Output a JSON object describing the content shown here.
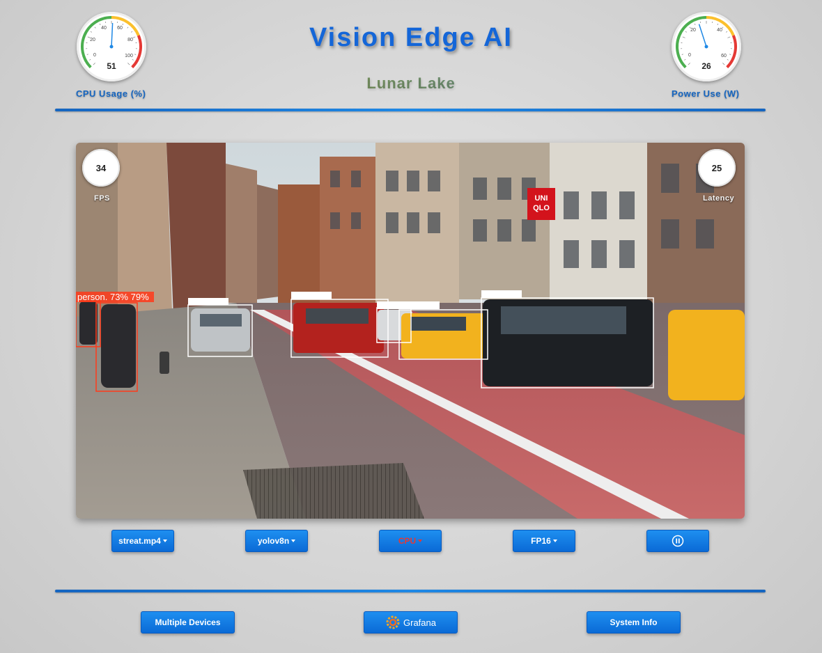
{
  "header": {
    "title": "Vision Edge AI",
    "subtitle": "Lunar Lake"
  },
  "gauges": {
    "cpu": {
      "label": "CPU Usage (%)",
      "value": "51",
      "value_num": 51,
      "min": 0,
      "max": 100,
      "ticks": [
        "0",
        "20",
        "40",
        "60",
        "80",
        "100"
      ]
    },
    "power": {
      "label": "Power Use (W)",
      "value": "26",
      "value_num": 26,
      "min": 0,
      "max": 60,
      "ticks": [
        "0",
        "20",
        "40",
        "60"
      ]
    }
  },
  "video": {
    "fps_value": "34",
    "fps_label": "FPS",
    "latency_value": "25",
    "latency_label": "Latency",
    "detection_label": "person. 73% 79%",
    "storefront_sign": "UNI QLO",
    "detection_colors": {
      "person": "#ff3a1a",
      "car": "#ffffff"
    }
  },
  "controls": {
    "source": "streat.mp4",
    "model": "yolov8n",
    "device": "CPU",
    "precision": "FP16",
    "play_pause_icon": "pause-icon"
  },
  "footer": {
    "multi_device": "Multiple Devices",
    "grafana": "Grafana",
    "grafana_icon": "grafana-logo-icon",
    "system_info": "System Info"
  },
  "colors": {
    "accent": "#1466d8",
    "button": "#0a6ad6",
    "device_text": "#e53935",
    "gauge_green": "#4caf50",
    "gauge_yellow": "#fbc02d",
    "gauge_red": "#e53935"
  }
}
